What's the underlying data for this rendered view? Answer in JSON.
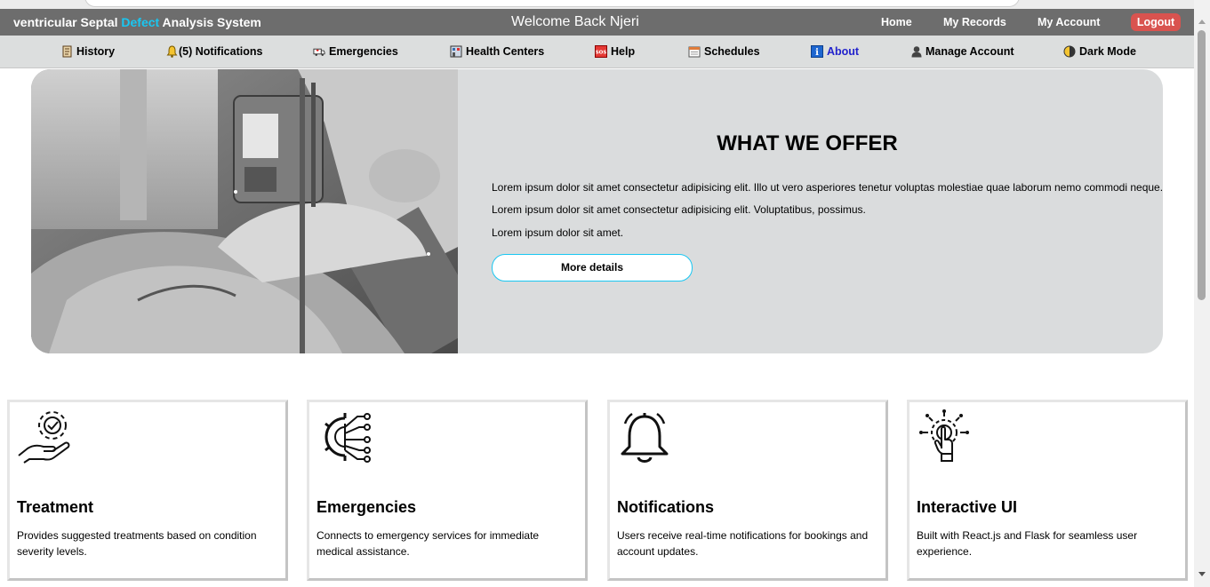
{
  "header": {
    "brand_part1": "ventricular Septal ",
    "brand_accent": "Defect",
    "brand_part2": " Analysis System",
    "welcome": "Welcome Back Njeri",
    "nav": {
      "home": "Home",
      "records": "My Records",
      "account": "My Account",
      "logout": "Logout"
    }
  },
  "menu": {
    "history": "History",
    "notifications": "(5) Notifications",
    "emergencies": "Emergencies",
    "health_centers": "Health Centers",
    "help": "Help",
    "schedules": "Schedules",
    "about": "About",
    "manage_account": "Manage Account",
    "dark_mode": "Dark Mode"
  },
  "hero": {
    "title": "WHAT WE OFFER",
    "line1": "Lorem ipsum dolor sit amet consectetur adipisicing elit. Illo ut vero asperiores tenetur voluptas molestiae quae laborum nemo commodi neque.",
    "line2": "Lorem ipsum dolor sit amet consectetur adipisicing elit. Voluptatibus, possimus.",
    "line3": "Lorem ipsum dolor sit amet.",
    "button": "More details"
  },
  "cards": [
    {
      "title": "Treatment",
      "desc": "Provides suggested treatments based on condition severity levels.",
      "icon": "hand-gear-icon"
    },
    {
      "title": "Emergencies",
      "desc": "Connects to emergency services for immediate medical assistance.",
      "icon": "gear-circuit-icon"
    },
    {
      "title": "Notifications",
      "desc": "Users receive real-time notifications for bookings and account updates.",
      "icon": "bell-icon"
    },
    {
      "title": "Interactive UI",
      "desc": "Built with React.js and Flask for seamless user experience.",
      "icon": "touch-icon"
    }
  ],
  "colors": {
    "accent": "#19c7f2",
    "header": "#6d6d6d",
    "logout": "#d9534f",
    "active_link": "#2222cc"
  }
}
